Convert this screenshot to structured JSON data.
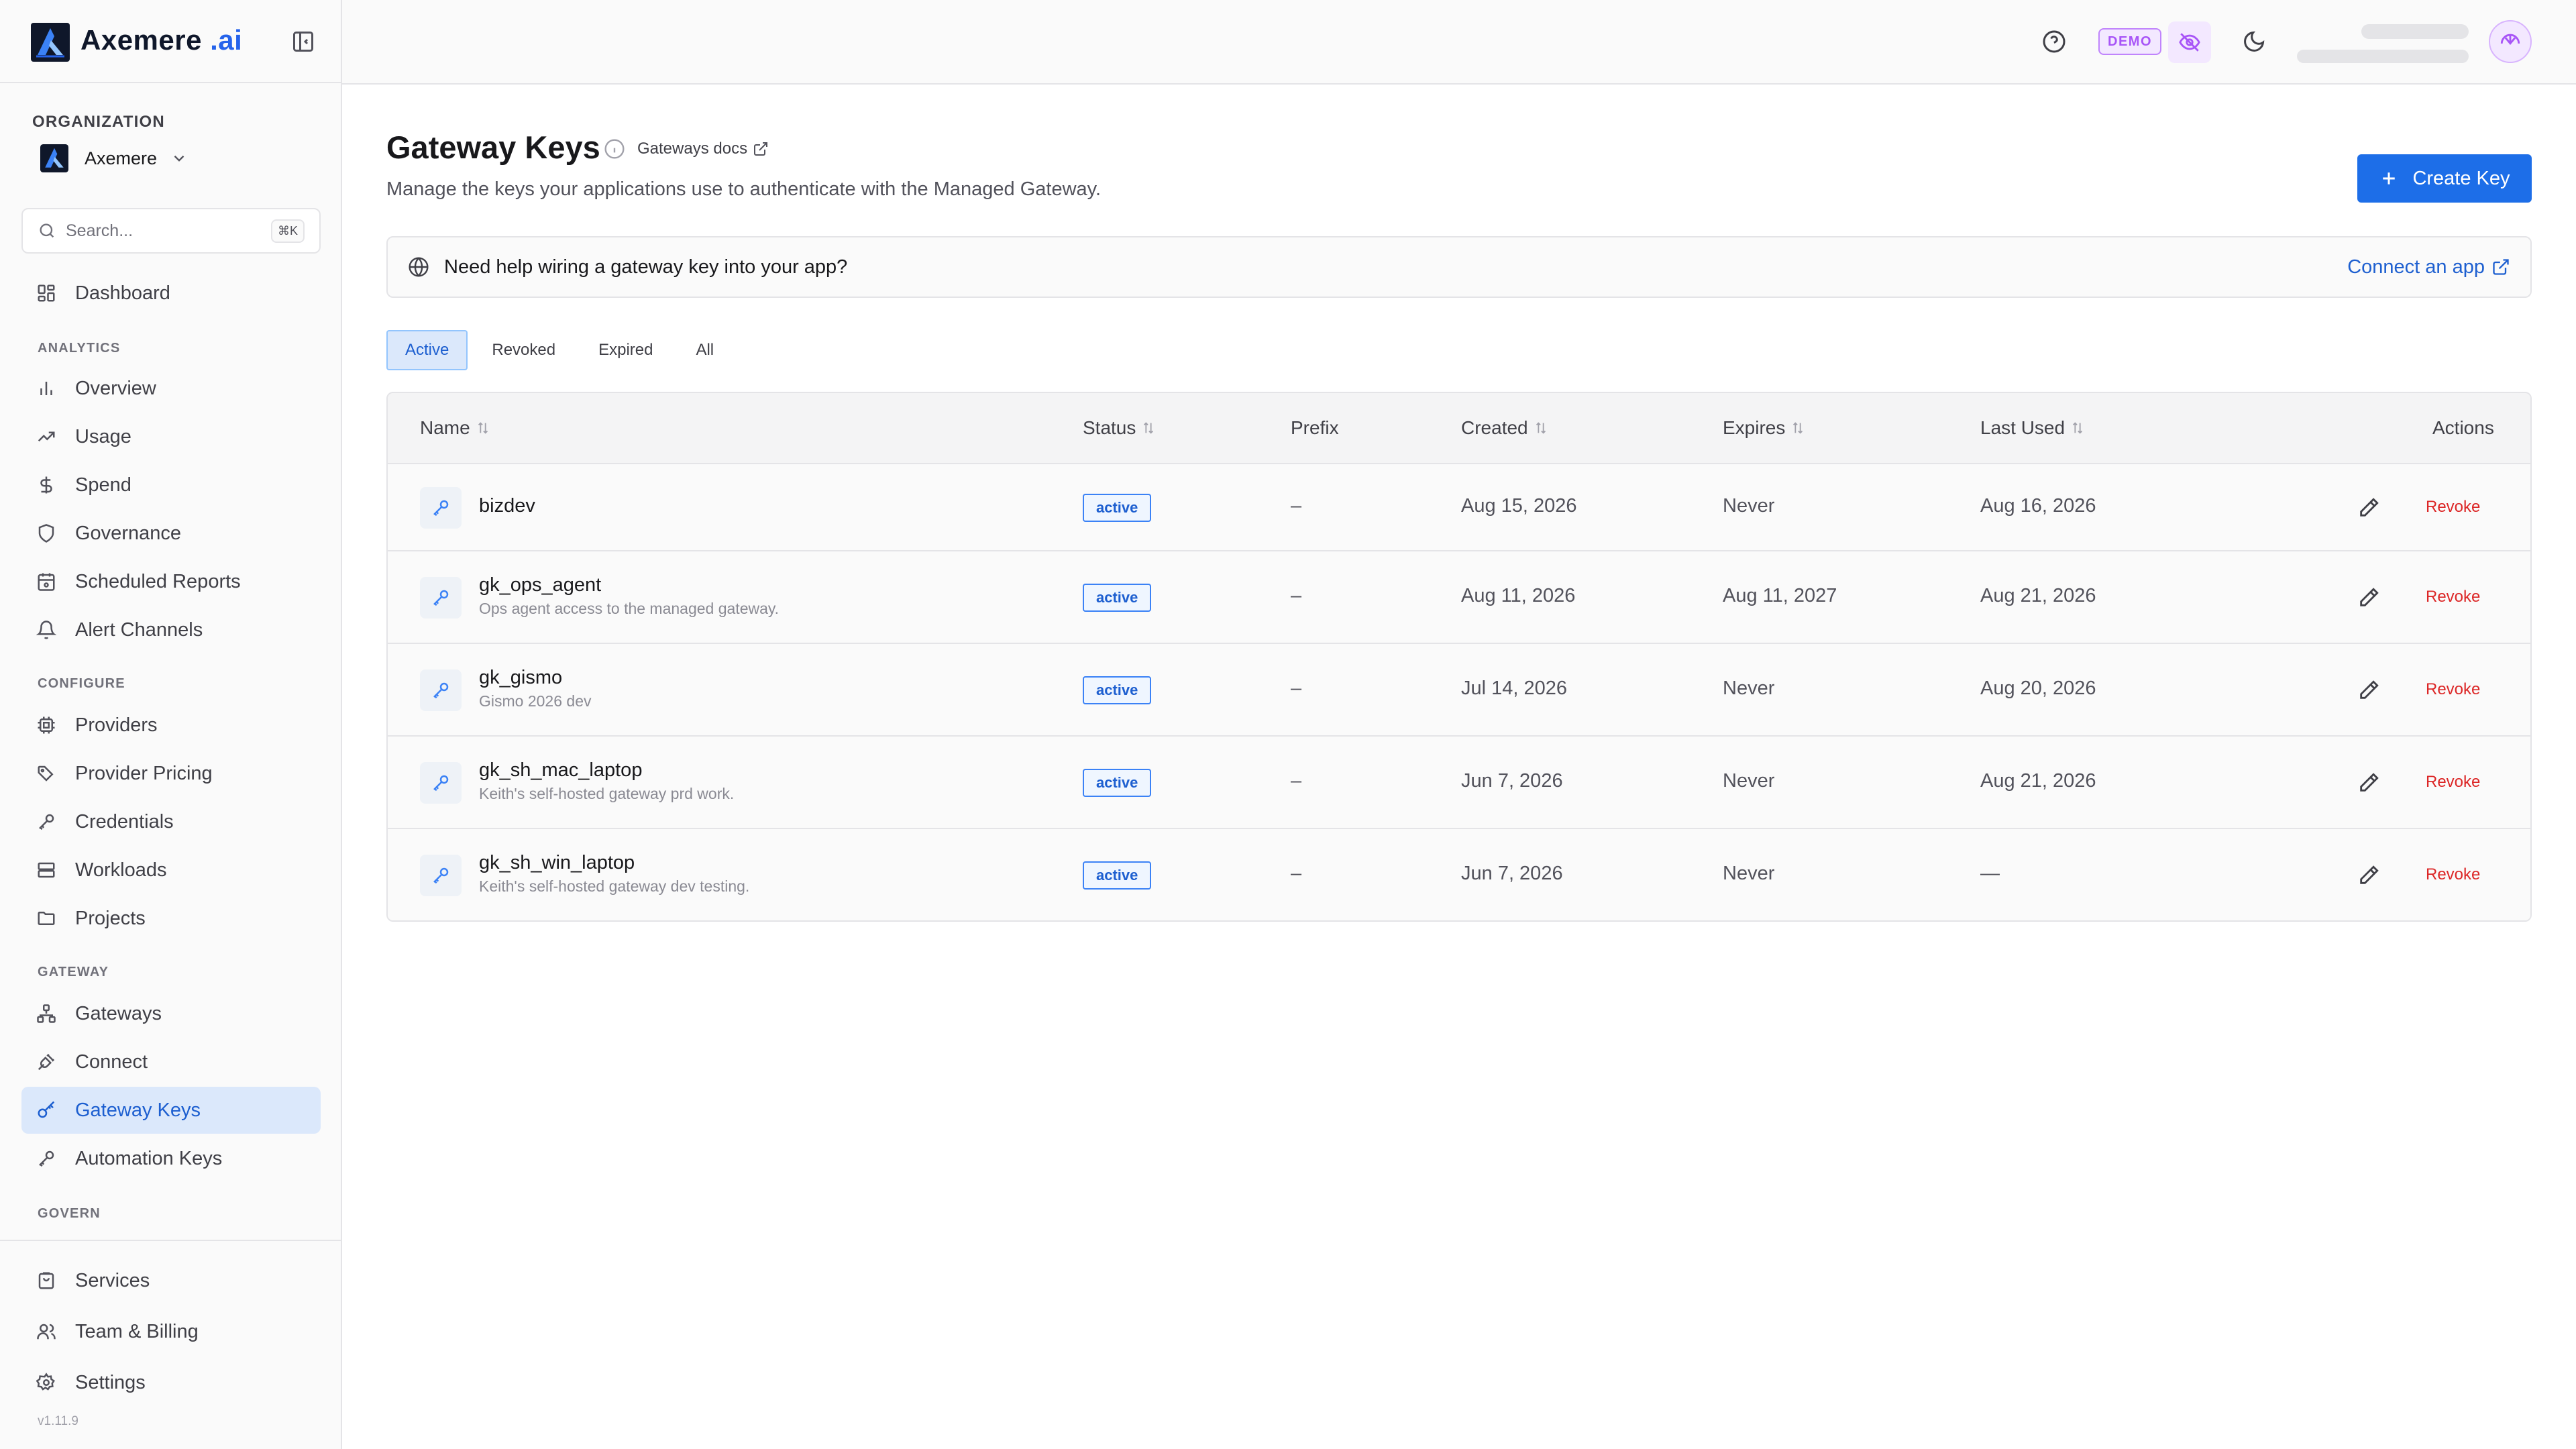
{
  "app": {
    "brand_name": "Axemere",
    "brand_suffix": ".ai",
    "version": "v1.11.9"
  },
  "sidebar": {
    "org_label": "ORGANIZATION",
    "org_name": "Axemere",
    "search_placeholder": "Search...",
    "search_shortcut": "⌘K",
    "dashboard": "Dashboard",
    "sections": {
      "analytics": "ANALYTICS",
      "configure": "CONFIGURE",
      "gateway": "GATEWAY",
      "govern": "GOVERN"
    },
    "analytics_items": [
      "Overview",
      "Usage",
      "Spend",
      "Governance",
      "Scheduled Reports",
      "Alert Channels"
    ],
    "configure_items": [
      "Providers",
      "Provider Pricing",
      "Credentials",
      "Workloads",
      "Projects"
    ],
    "gateway_items": [
      "Gateways",
      "Connect",
      "Gateway Keys",
      "Automation Keys"
    ],
    "bottom_items": [
      "Services",
      "Team & Billing",
      "Settings"
    ],
    "active_item": "Gateway Keys"
  },
  "topbar": {
    "demo_badge": "DEMO"
  },
  "page": {
    "title": "Gateway Keys",
    "docs_link": "Gateways docs",
    "subtitle": "Manage the keys your applications use to authenticate with the Managed Gateway.",
    "create_button": "Create Key"
  },
  "help_banner": {
    "text": "Need help wiring a gateway key into your app?",
    "link": "Connect an app"
  },
  "tabs": [
    "Active",
    "Revoked",
    "Expired",
    "All"
  ],
  "active_tab": "Active",
  "table": {
    "columns": {
      "name": "Name",
      "status": "Status",
      "prefix": "Prefix",
      "created": "Created",
      "expires": "Expires",
      "last_used": "Last Used",
      "actions": "Actions"
    },
    "revoke_label": "Revoke",
    "rows": [
      {
        "name": "bizdev",
        "description": "",
        "status": "active",
        "prefix": "–",
        "created": "Aug 15, 2026",
        "expires": "Never",
        "last_used": "Aug 16, 2026"
      },
      {
        "name": "gk_ops_agent",
        "description": "Ops agent access to the managed gateway.",
        "status": "active",
        "prefix": "–",
        "created": "Aug 11, 2026",
        "expires": "Aug 11, 2027",
        "last_used": "Aug 21, 2026"
      },
      {
        "name": "gk_gismo",
        "description": "Gismo 2026 dev",
        "status": "active",
        "prefix": "–",
        "created": "Jul 14, 2026",
        "expires": "Never",
        "last_used": "Aug 20, 2026"
      },
      {
        "name": "gk_sh_mac_laptop",
        "description": "Keith's self-hosted gateway prd work.",
        "status": "active",
        "prefix": "–",
        "created": "Jun 7, 2026",
        "expires": "Never",
        "last_used": "Aug 21, 2026"
      },
      {
        "name": "gk_sh_win_laptop",
        "description": "Keith's self-hosted gateway dev testing.",
        "status": "active",
        "prefix": "–",
        "created": "Jun 7, 2026",
        "expires": "Never",
        "last_used": "—"
      }
    ]
  },
  "colors": {
    "accent": "#1d6ee8",
    "active_nav_bg": "#dbe8fb",
    "danger": "#dc2626",
    "demo_purple": "#a855f7"
  }
}
